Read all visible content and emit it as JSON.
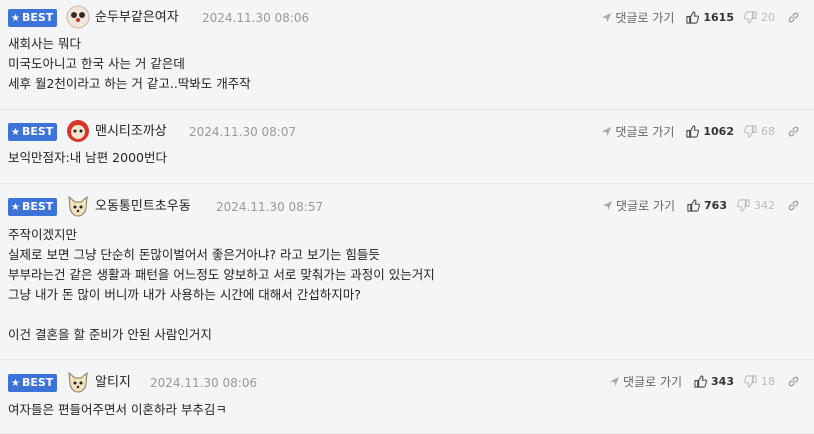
{
  "ui": {
    "best_label": "BEST",
    "reply_label": "댓글로 가기"
  },
  "comments": [
    {
      "nickname": "순두부같은여자",
      "datetime": "2024.11.30 08:06",
      "upvotes": "1615",
      "downvotes": "20",
      "lines": [
        "새회사는 뭐다",
        "미국도아니고 한국 사는 거 같은데",
        "세후 월2천이라고 하는 거 같고..딱봐도 개주작"
      ]
    },
    {
      "nickname": "맨시티조까상",
      "datetime": "2024.11.30 08:07",
      "upvotes": "1062",
      "downvotes": "68",
      "lines": [
        "보익만점자:내 남편 2000번다"
      ]
    },
    {
      "nickname": "오동통민트초우동",
      "datetime": "2024.11.30 08:57",
      "upvotes": "763",
      "downvotes": "342",
      "lines": [
        "주작이겠지만",
        "실제로 보면 그냥 단순히 돈많이벌어서 좋은거아냐? 라고 보기는 힘들듯",
        "부부라는건 같은 생활과 패턴을 어느정도 양보하고 서로 맞춰가는 과정이 있는거지",
        "그냥 내가 돈 많이 버니까 내가 사용하는 시간에 대해서 간섭하지마?",
        "",
        "이건 결혼을 할 준비가 안된 사람인거지"
      ]
    },
    {
      "nickname": "알티지",
      "datetime": "2024.11.30 08:06",
      "upvotes": "343",
      "downvotes": "18",
      "lines": [
        "여자들은 편들어주면서 이혼하라 부추김ㅋ"
      ]
    }
  ]
}
